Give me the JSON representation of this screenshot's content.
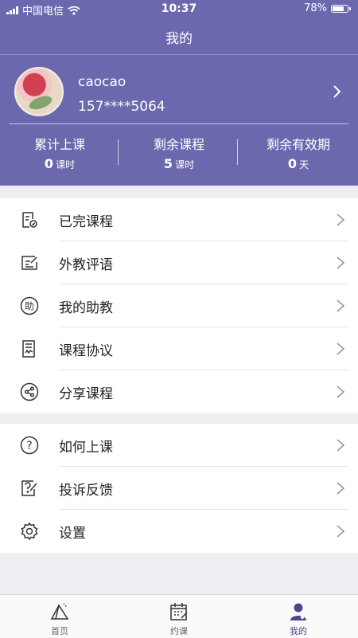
{
  "status_bar": {
    "carrier": "中国电信",
    "time": "10:37",
    "battery": "78%"
  },
  "nav": {
    "title": "我的"
  },
  "profile": {
    "username": "caocao",
    "phone": "157****5064"
  },
  "stats": [
    {
      "label": "累计上课",
      "value": "0",
      "unit": "课时"
    },
    {
      "label": "剩余课程",
      "value": "5",
      "unit": "课时"
    },
    {
      "label": "剩余有效期",
      "value": "0",
      "unit": "天"
    }
  ],
  "menu_group1": [
    {
      "label": "已完课程",
      "icon": "completed-course-icon"
    },
    {
      "label": "外教评语",
      "icon": "teacher-comment-icon"
    },
    {
      "label": "我的助教",
      "icon": "assistant-icon"
    },
    {
      "label": "课程协议",
      "icon": "agreement-icon"
    },
    {
      "label": "分享课程",
      "icon": "share-icon"
    }
  ],
  "menu_group2": [
    {
      "label": "如何上课",
      "icon": "help-icon"
    },
    {
      "label": "投诉反馈",
      "icon": "feedback-icon"
    },
    {
      "label": "设置",
      "icon": "settings-icon"
    }
  ],
  "tabbar": [
    {
      "label": "首页",
      "icon": "home-icon"
    },
    {
      "label": "约课",
      "icon": "calendar-icon"
    },
    {
      "label": "我的",
      "icon": "profile-icon",
      "active": true
    }
  ],
  "colors": {
    "header": "#6b68ae",
    "background": "#efeef3",
    "tab_active": "#4a4690"
  }
}
